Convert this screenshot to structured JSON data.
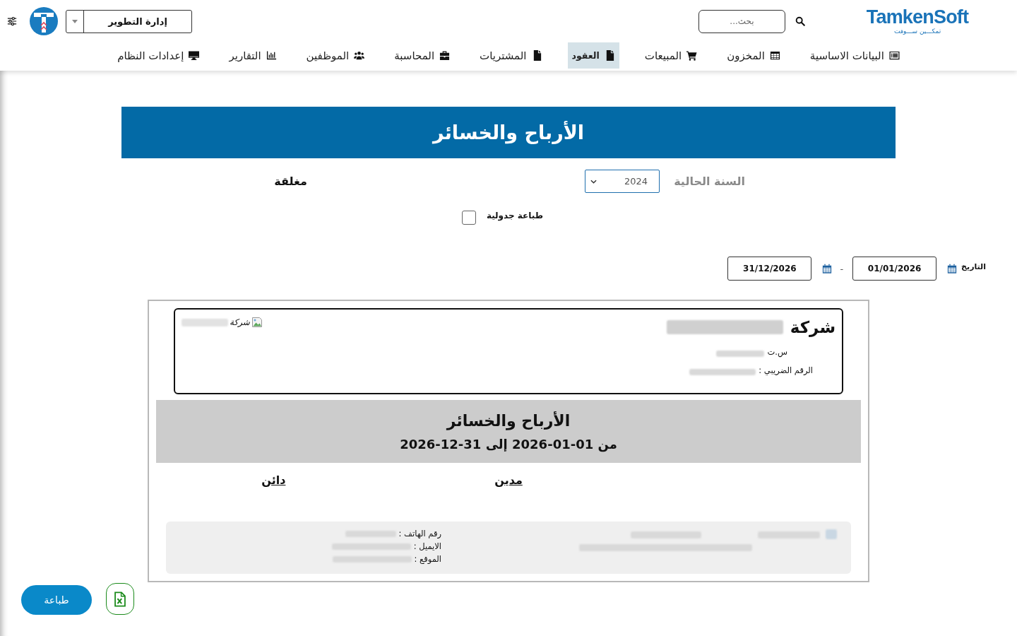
{
  "header": {
    "logo": {
      "wordmark": "TamkenSoft",
      "tagline": "تمكـــين ســـوفت"
    },
    "search": {
      "placeholder": "بحث..."
    },
    "department_select": {
      "value": "إدارة التطوير"
    }
  },
  "nav": [
    {
      "label": "البيانات الاساسية",
      "selected": false
    },
    {
      "label": "المخزون",
      "selected": false
    },
    {
      "label": "المبيعات",
      "selected": false
    },
    {
      "label": "العقود",
      "selected": true
    },
    {
      "label": "المشتريات",
      "selected": false
    },
    {
      "label": "المحاسبة",
      "selected": false
    },
    {
      "label": "الموظفين",
      "selected": false
    },
    {
      "label": "التقارير",
      "selected": false
    },
    {
      "label": "إعدادات النظام",
      "selected": false
    }
  ],
  "page_title": "الأرباح والخسائر",
  "filters": {
    "year_label": "السنة الحالية",
    "year": "2024",
    "status": "مغلقة",
    "tabular_print": {
      "label": "طباعة جدولية",
      "checked": false
    },
    "date_label": "التاريخ",
    "date_from": "01/01/2026",
    "separator": "-",
    "date_to": "31/12/2026"
  },
  "report": {
    "company": {
      "name_prefix": "شركة",
      "logo_alt": "شركة",
      "cr_label": "س.ت",
      "tax_label": "الرقم الضريبي :"
    },
    "title": "الأرباح والخسائر",
    "period": "من 01-01-2026 إلى 31-12-2026",
    "columns": [
      "مدين",
      "دائن"
    ],
    "footer": {
      "phone_label": "رقم الهاتف :",
      "email_label": "الايميل :",
      "website_label": "الموقع :"
    }
  },
  "actions": {
    "print": "طباعة"
  }
}
